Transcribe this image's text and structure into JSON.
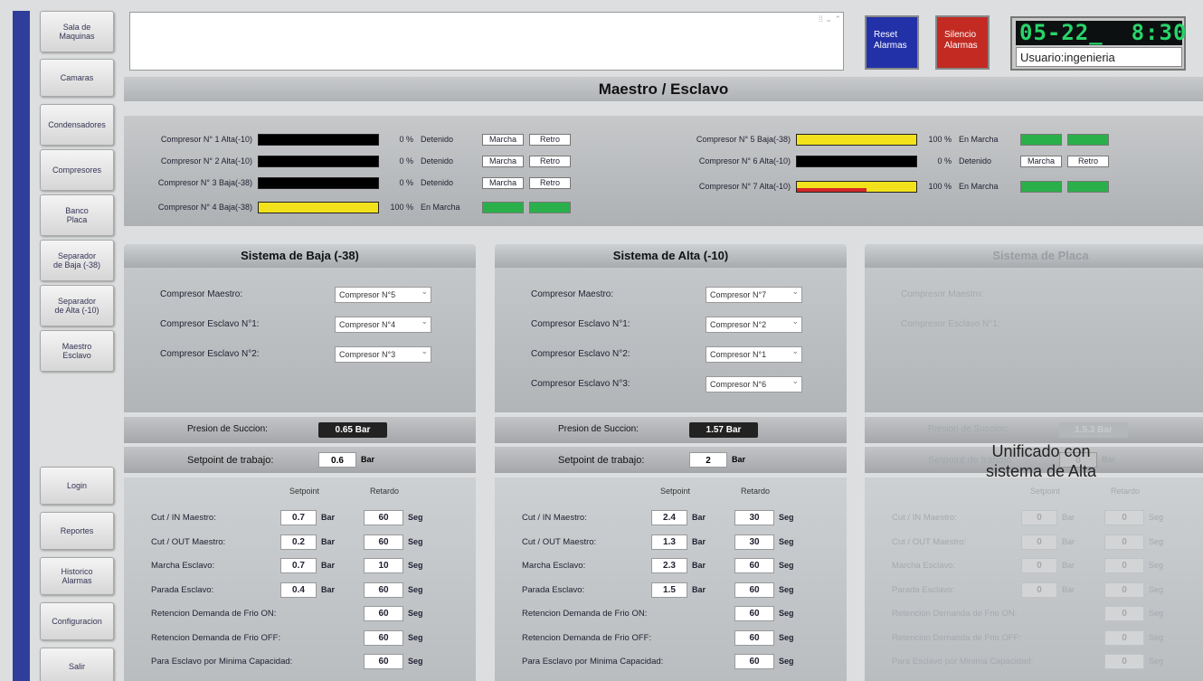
{
  "sidebar": {
    "top": [
      "Sala de\nMaquinas",
      "Camaras",
      "Condensadores",
      "Compresores",
      "Banco\nPlaca",
      "Separador\nde Baja (-38)",
      "Separador\nde Alta (-10)",
      "Maestro\nEsclavo"
    ],
    "bottom": [
      "Login",
      "Reportes",
      "Historico\nAlarmas",
      "Configuracion",
      "Salir"
    ]
  },
  "header": {
    "reset_label": "Reset\nAlarmas",
    "silence_label": "Silencio\nAlarmas",
    "clock": "05-22_  8:30",
    "user": "Usuario:ingenieria",
    "title": "Maestro / Esclavo"
  },
  "compressors": [
    {
      "label": "Compresor N° 1  Alta(-10)",
      "pct_text": "0 %",
      "level": 0,
      "state": "Detenido",
      "marcha": "Marcha",
      "retro": "Retro",
      "on": false,
      "red": false
    },
    {
      "label": "Compresor N° 2  Alta(-10)",
      "pct_text": "0 %",
      "level": 0,
      "state": "Detenido",
      "marcha": "Marcha",
      "retro": "Retro",
      "on": false,
      "red": false
    },
    {
      "label": "Compresor N° 3  Baja(-38)",
      "pct_text": "0 %",
      "level": 0,
      "state": "Detenido",
      "marcha": "Marcha",
      "retro": "Retro",
      "on": false,
      "red": false
    },
    {
      "label": "Compresor N° 4  Baja(-38)",
      "pct_text": "100 %",
      "level": 100,
      "state": "En Marcha",
      "marcha": "Marcha",
      "retro": "Retro",
      "on": true,
      "red": false
    },
    {
      "label": "Compresor N° 5  Baja(-38)",
      "pct_text": "100 %",
      "level": 100,
      "state": "En Marcha",
      "marcha": "Marcha",
      "retro": "Retro",
      "on": true,
      "red": false
    },
    {
      "label": "Compresor N° 6  Alta(-10)",
      "pct_text": "0 %",
      "level": 0,
      "state": "Detenido",
      "marcha": "Marcha",
      "retro": "Retro",
      "on": false,
      "red": false
    },
    {
      "label": "Compresor N° 7  Alta(-10)",
      "pct_text": "100 %",
      "level": 100,
      "state": "En Marcha",
      "marcha": "Marcha",
      "retro": "Retro",
      "on": true,
      "red": true
    }
  ],
  "systems": [
    {
      "title": "Sistema de Baja (-38)",
      "disabled": false,
      "selects": [
        {
          "label": "Compresor Maestro:",
          "value": "Compresor N°5"
        },
        {
          "label": "Compresor Esclavo N°1:",
          "value": "Compresor N°4"
        },
        {
          "label": "Compresor Esclavo N°2:",
          "value": "Compresor N°3"
        }
      ],
      "pressure_label": "Presion de Succion:",
      "pressure_value": "0.65 Bar",
      "setpoint_label": "Setpoint de trabajo:",
      "setpoint_value": "0.6",
      "setpoint_unit": "Bar",
      "col_setpoint": "Setpoint",
      "col_retardo": "Retardo",
      "rows": [
        {
          "label": "Cut / IN Maestro:",
          "sp": "0.7",
          "sp_unit": "Bar",
          "ret": "60",
          "ret_unit": "Seg"
        },
        {
          "label": "Cut / OUT Maestro:",
          "sp": "0.2",
          "sp_unit": "Bar",
          "ret": "60",
          "ret_unit": "Seg"
        },
        {
          "label": "Marcha Esclavo:",
          "sp": "0.7",
          "sp_unit": "Bar",
          "ret": "10",
          "ret_unit": "Seg"
        },
        {
          "label": "Parada Esclavo:",
          "sp": "0.4",
          "sp_unit": "Bar",
          "ret": "60",
          "ret_unit": "Seg"
        },
        {
          "label": "Retencion Demanda de Frio ON:",
          "sp": "",
          "sp_unit": "",
          "ret": "60",
          "ret_unit": "Seg"
        },
        {
          "label": "Retencion Demanda de Frio OFF:",
          "sp": "",
          "sp_unit": "",
          "ret": "60",
          "ret_unit": "Seg"
        },
        {
          "label": "Para Esclavo por Minima Capacidad:",
          "sp": "",
          "sp_unit": "",
          "ret": "60",
          "ret_unit": "Seg"
        }
      ]
    },
    {
      "title": "Sistema de Alta (-10)",
      "disabled": false,
      "selects": [
        {
          "label": "Compresor Maestro:",
          "value": "Compresor N°7"
        },
        {
          "label": "Compresor Esclavo N°1:",
          "value": "Compresor N°2"
        },
        {
          "label": "Compresor Esclavo N°2:",
          "value": "Compresor N°1"
        },
        {
          "label": "Compresor Esclavo N°3:",
          "value": "Compresor N°6"
        }
      ],
      "pressure_label": "Presion de Succion:",
      "pressure_value": "1.57 Bar",
      "setpoint_label": "Setpoint de trabajo:",
      "setpoint_value": "2",
      "setpoint_unit": "Bar",
      "col_setpoint": "Setpoint",
      "col_retardo": "Retardo",
      "rows": [
        {
          "label": "Cut / IN Maestro:",
          "sp": "2.4",
          "sp_unit": "Bar",
          "ret": "30",
          "ret_unit": "Seg"
        },
        {
          "label": "Cut / OUT Maestro:",
          "sp": "1.3",
          "sp_unit": "Bar",
          "ret": "30",
          "ret_unit": "Seg"
        },
        {
          "label": "Marcha Esclavo:",
          "sp": "2.3",
          "sp_unit": "Bar",
          "ret": "60",
          "ret_unit": "Seg"
        },
        {
          "label": "Parada Esclavo:",
          "sp": "1.5",
          "sp_unit": "Bar",
          "ret": "60",
          "ret_unit": "Seg"
        },
        {
          "label": "Retencion Demanda de Frio ON:",
          "sp": "",
          "sp_unit": "",
          "ret": "60",
          "ret_unit": "Seg"
        },
        {
          "label": "Retencion Demanda de Frio OFF:",
          "sp": "",
          "sp_unit": "",
          "ret": "60",
          "ret_unit": "Seg"
        },
        {
          "label": "Para Esclavo por Minima Capacidad:",
          "sp": "",
          "sp_unit": "",
          "ret": "60",
          "ret_unit": "Seg"
        }
      ]
    },
    {
      "title": "Sistema de Placa",
      "disabled": true,
      "selects": [
        {
          "label": "Compresor Maestro:",
          "value": ""
        },
        {
          "label": "Compresor Esclavo N°1:",
          "value": ""
        }
      ],
      "pressure_label": "Presion de Succion:",
      "pressure_value": "1.5.3 Bar",
      "setpoint_label": "Setpoint de trabajo:",
      "setpoint_value": "0",
      "setpoint_unit": "Bar",
      "col_setpoint": "Setpoint",
      "col_retardo": "Retardo",
      "rows": [
        {
          "label": "Cut / IN Maestro:",
          "sp": "0",
          "sp_unit": "Bar",
          "ret": "0",
          "ret_unit": "Seg"
        },
        {
          "label": "Cut / OUT Maestro:",
          "sp": "0",
          "sp_unit": "Bar",
          "ret": "0",
          "ret_unit": "Seg"
        },
        {
          "label": "Marcha Esclavo:",
          "sp": "0",
          "sp_unit": "Bar",
          "ret": "0",
          "ret_unit": "Seg"
        },
        {
          "label": "Parada Esclavo:",
          "sp": "0",
          "sp_unit": "Bar",
          "ret": "0",
          "ret_unit": "Seg"
        },
        {
          "label": "Retencion Demanda de Frio ON:",
          "sp": "",
          "sp_unit": "",
          "ret": "0",
          "ret_unit": "Seg"
        },
        {
          "label": "Retencion Demanda de Frio OFF:",
          "sp": "",
          "sp_unit": "",
          "ret": "0",
          "ret_unit": "Seg"
        },
        {
          "label": "Para Esclavo por Minima Capacidad:",
          "sp": "",
          "sp_unit": "",
          "ret": "0",
          "ret_unit": "Seg"
        }
      ]
    }
  ],
  "placa_note": "Unificado con\nsistema de Alta",
  "colors": {
    "running": "#2ab04a",
    "bar_fill": "#f2e21c",
    "alarm_red": "#d42828",
    "reset_blue": "#2231a8",
    "silence_red": "#c22a22"
  }
}
